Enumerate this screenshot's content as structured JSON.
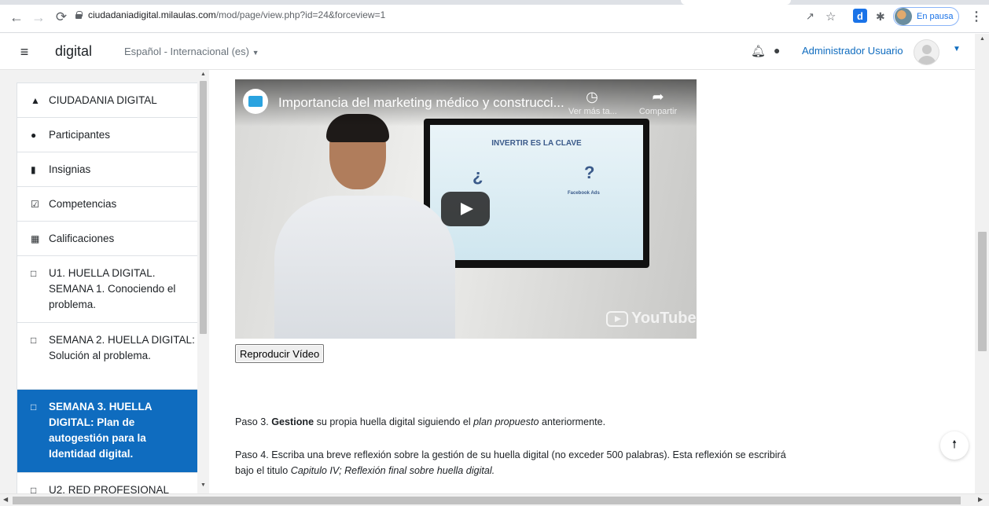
{
  "browser": {
    "url_host": "ciudadaniadigital.milaulas.com",
    "url_path": "/mod/page/view.php?id=24&forceview=1",
    "profile_status": "En pausa",
    "ext_label": "d"
  },
  "navbar": {
    "brand": "digital",
    "language": "Español - Internacional (es)",
    "user_name": "Administrador Usuario"
  },
  "sidebar": {
    "items": [
      {
        "icon": "graduation-cap-icon",
        "label": "CIUDADANIA DIGITAL"
      },
      {
        "icon": "users-icon",
        "label": "Participantes"
      },
      {
        "icon": "shield-icon",
        "label": "Insignias"
      },
      {
        "icon": "checkbox-icon",
        "label": "Competencias"
      },
      {
        "icon": "table-icon",
        "label": "Calificaciones"
      },
      {
        "icon": "folder-icon",
        "label": "U1. HUELLA DIGITAL. SEMANA 1. Conociendo el problema."
      },
      {
        "icon": "folder-icon",
        "label": "SEMANA 2. HUELLA DIGITAL: Solución al problema."
      },
      {
        "icon": "folder-icon",
        "label": "SEMANA 3. HUELLA DIGITAL: Plan de autogestión para la Identidad digital.",
        "active": true
      },
      {
        "icon": "folder-icon",
        "label": "U2. RED PROFESIONAL"
      }
    ]
  },
  "video": {
    "title": "Importancia del marketing médico y construcci...",
    "watch_later": "Ver más ta...",
    "share": "Compartir",
    "tv_heading": "INVERTIR ES LA CLAVE",
    "tv_q1": "¿",
    "tv_q2": "?",
    "tv_label": "Facebook Ads",
    "youtube_logo": "YouTube",
    "play_button_label": "Reproducir Vídeo"
  },
  "content": {
    "paso3_prefix": "Paso 3. ",
    "paso3_bold": "Gestione",
    "paso3_mid": " su propia huella digital siguiendo el ",
    "paso3_italic": "plan propuesto",
    "paso3_end": " anteriormente.",
    "paso4_text": "Paso 4. Escriba una breve reflexión sobre la gestión de su huella digital (no exceder 500 palabras). Esta reflexión se escribirá bajo el titulo ",
    "paso4_italic": "Capitulo IV; Reflexión final sobre huella digital."
  },
  "colors": {
    "primary": "#0f6cbf",
    "drawer_bg": "#f2f2f2"
  }
}
